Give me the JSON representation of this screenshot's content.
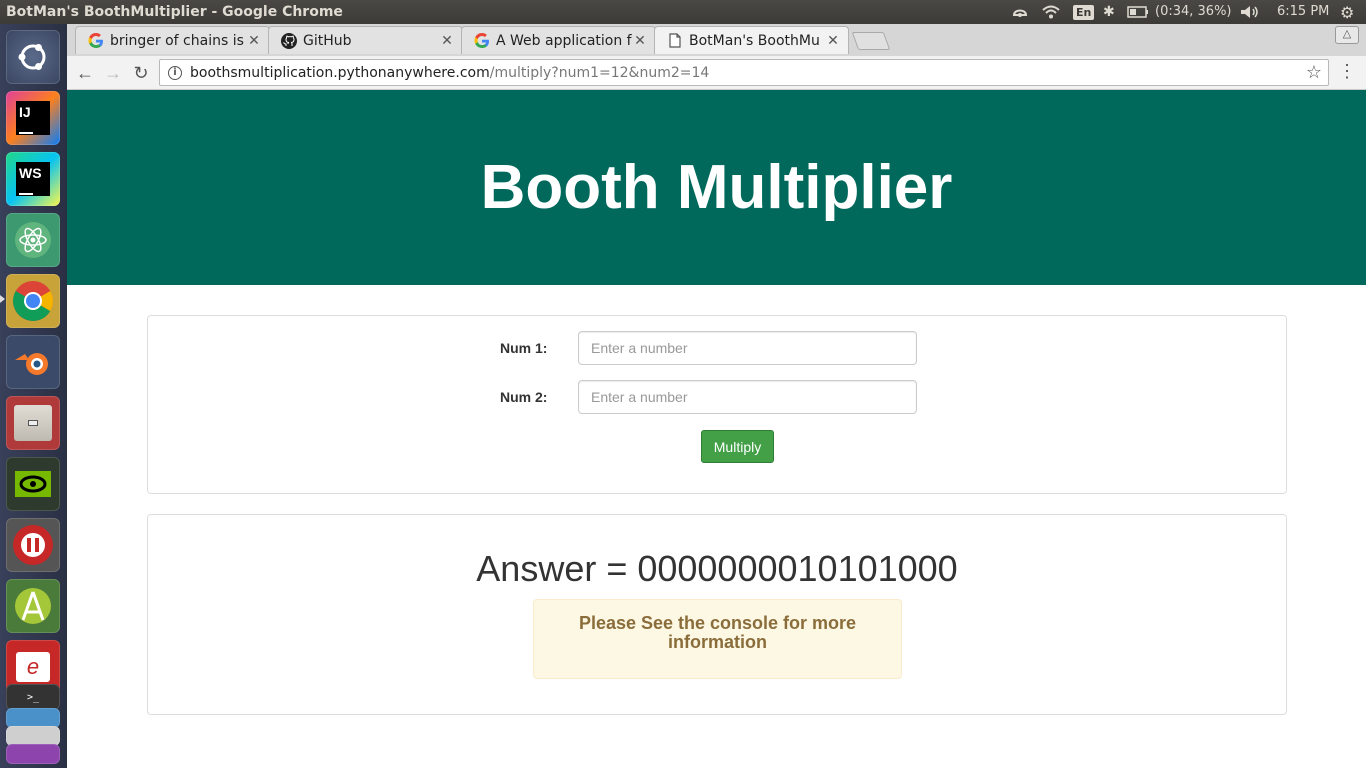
{
  "system": {
    "window_title": "BotMan's BoothMultiplier - Google Chrome",
    "lang": "En",
    "battery": "(0:34, 36%)",
    "clock": "6:15 PM"
  },
  "browser": {
    "tabs": [
      {
        "label": "bringer of chains is",
        "icon": "google-icon"
      },
      {
        "label": "GitHub",
        "icon": "github-icon"
      },
      {
        "label": "A Web application f",
        "icon": "google-icon"
      },
      {
        "label": "BotMan's BoothMu",
        "icon": "page-icon"
      }
    ],
    "url_host": "boothsmultiplication.pythonanywhere.com",
    "url_path": "/multiply?num1=12&num2=14"
  },
  "page": {
    "title": "Booth Multiplier",
    "form": {
      "num1_label": "Num 1:",
      "num2_label": "Num 2:",
      "num1_placeholder": "Enter a number",
      "num2_placeholder": "Enter a number",
      "submit_label": "Multiply"
    },
    "answer": "Answer = 0000000010101000",
    "alert": "Please See the console for more information"
  },
  "colors": {
    "header_bg": "#00695c",
    "button_bg": "#43a047",
    "alert_bg": "#fcf8e3",
    "alert_text": "#8a6d3b"
  }
}
